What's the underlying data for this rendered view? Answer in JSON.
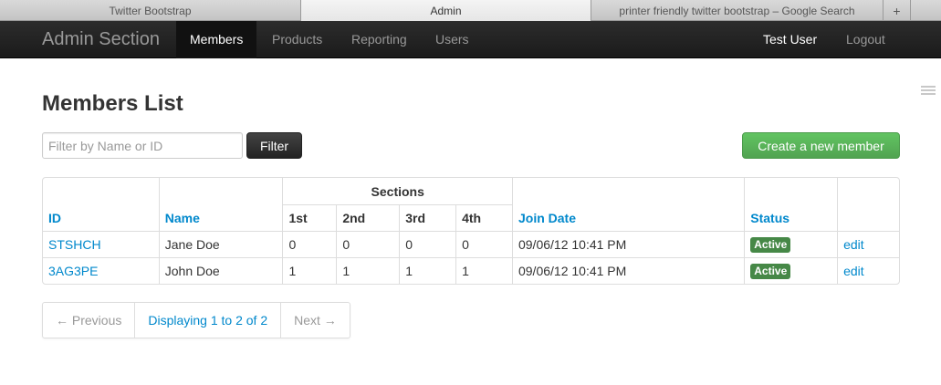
{
  "browser": {
    "tabs": [
      "Twitter Bootstrap",
      "Admin",
      "printer friendly twitter bootstrap – Google Search"
    ],
    "new_tab_symbol": "+"
  },
  "navbar": {
    "brand": "Admin Section",
    "items": [
      "Members",
      "Products",
      "Reporting",
      "Users"
    ],
    "active_item": "Members",
    "user": "Test User",
    "logout": "Logout"
  },
  "page": {
    "title": "Members List",
    "filter_placeholder": "Filter by Name or ID",
    "filter_button": "Filter",
    "create_button": "Create a new member"
  },
  "table": {
    "headers": {
      "id": "ID",
      "name": "Name",
      "sections": "Sections",
      "section_cols": [
        "1st",
        "2nd",
        "3rd",
        "4th"
      ],
      "join_date": "Join Date",
      "status": "Status"
    },
    "rows": [
      {
        "id": "STSHCH",
        "name": "Jane Doe",
        "sections": [
          "0",
          "0",
          "0",
          "0"
        ],
        "join_date": "09/06/12 10:41 PM",
        "status": "Active",
        "action": "edit"
      },
      {
        "id": "3AG3PE",
        "name": "John Doe",
        "sections": [
          "1",
          "1",
          "1",
          "1"
        ],
        "join_date": "09/06/12 10:41 PM",
        "status": "Active",
        "action": "edit"
      }
    ]
  },
  "pagination": {
    "previous": "← Previous",
    "info": "Displaying 1 to 2 of 2",
    "next": "Next →"
  },
  "colors": {
    "link": "#0088cc",
    "success": "#5bb75b",
    "badge_success": "#468847",
    "navbar": "#1b1b1b"
  }
}
